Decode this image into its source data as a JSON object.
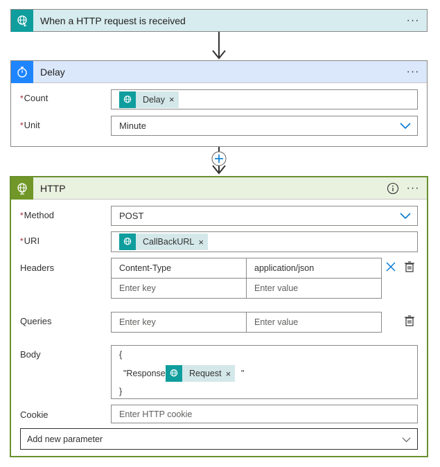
{
  "trigger": {
    "title": "When a HTTP request is received",
    "more": "···"
  },
  "delay": {
    "title": "Delay",
    "more": "···",
    "count_label": "Count",
    "count_token": "Delay",
    "unit_label": "Unit",
    "unit_value": "Minute"
  },
  "http": {
    "title": "HTTP",
    "more": "···",
    "method_label": "Method",
    "method_value": "POST",
    "uri_label": "URI",
    "uri_token": "CallBackURL",
    "headers_label": "Headers",
    "headers": [
      {
        "key": "Content-Type",
        "value": "application/json"
      }
    ],
    "key_placeholder": "Enter key",
    "value_placeholder": "Enter value",
    "queries_label": "Queries",
    "body_label": "Body",
    "body_open": "{",
    "body_key": "\"Response\": \"",
    "body_token": "Request",
    "body_quote": "\"",
    "body_close": "}",
    "cookie_label": "Cookie",
    "cookie_placeholder": "Enter HTTP cookie",
    "add_param": "Add new parameter"
  },
  "required_mark": "*",
  "token_close": "×",
  "colors": {
    "trigger_teal": "#0f9d9d",
    "delay_blue": "#1f85ff",
    "http_green": "#709727",
    "http_border": "#69902c",
    "accent_blue": "#0078d4"
  }
}
